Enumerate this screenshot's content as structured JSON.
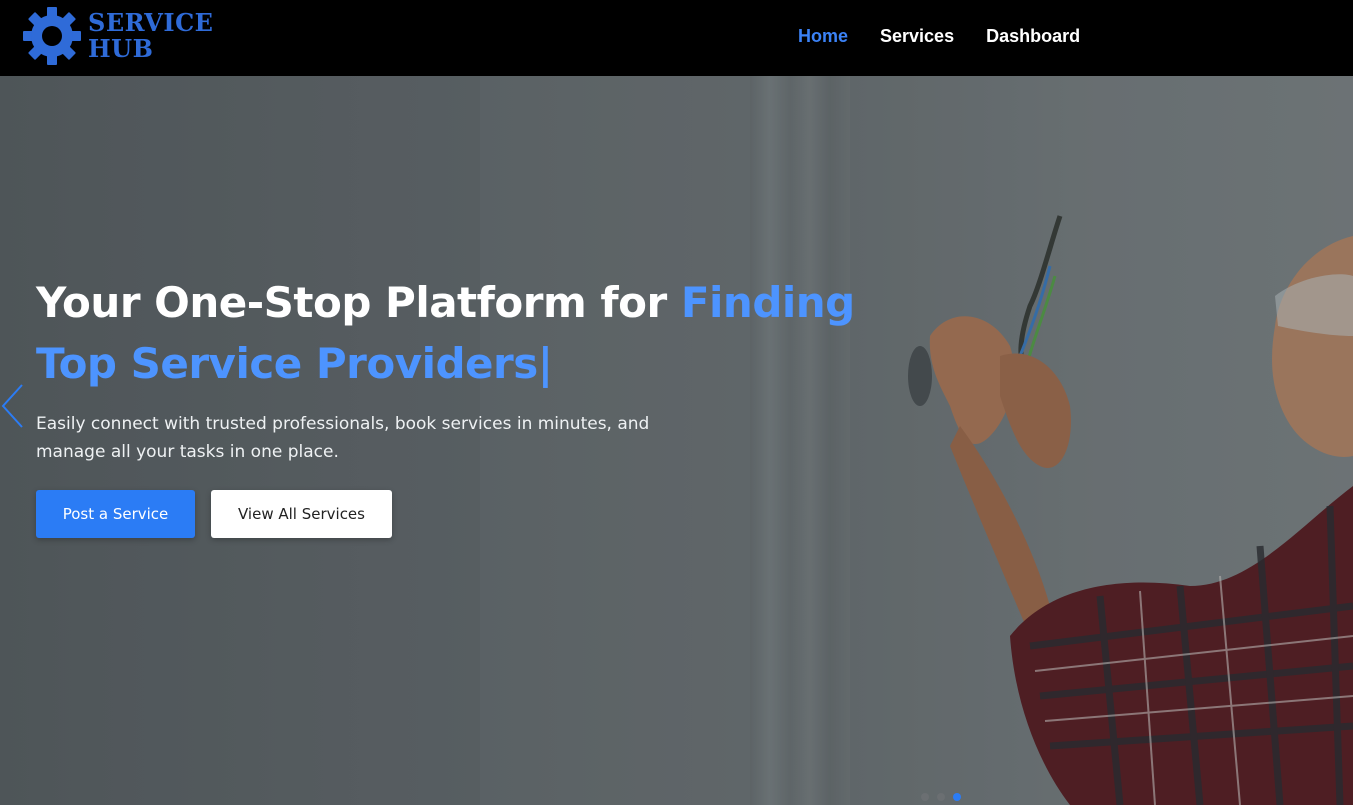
{
  "brand": {
    "line1": "SERVICE",
    "line2": "HUB",
    "icon": "gear-icon",
    "color": "#2f6bd8"
  },
  "nav": {
    "items": [
      {
        "label": "Home",
        "active": true
      },
      {
        "label": "Services",
        "active": false
      },
      {
        "label": "Dashboard",
        "active": false
      }
    ]
  },
  "hero": {
    "headline_prefix": "Your One-Stop Platform for ",
    "headline_highlight": "Finding Top Service Providers|",
    "subtext": "Easily connect with trusted professionals, book services in minutes, and manage all your tasks in one place.",
    "primary_button": "Post a Service",
    "secondary_button": "View All Services",
    "prev_icon": "chevron-left-icon"
  },
  "carousel": {
    "slide_count": 3,
    "active_slide": 3
  },
  "colors": {
    "accent": "#2b7cf5",
    "highlight": "#4d94ff",
    "nav_active": "#3b82f6",
    "navbar_bg": "#000000"
  }
}
